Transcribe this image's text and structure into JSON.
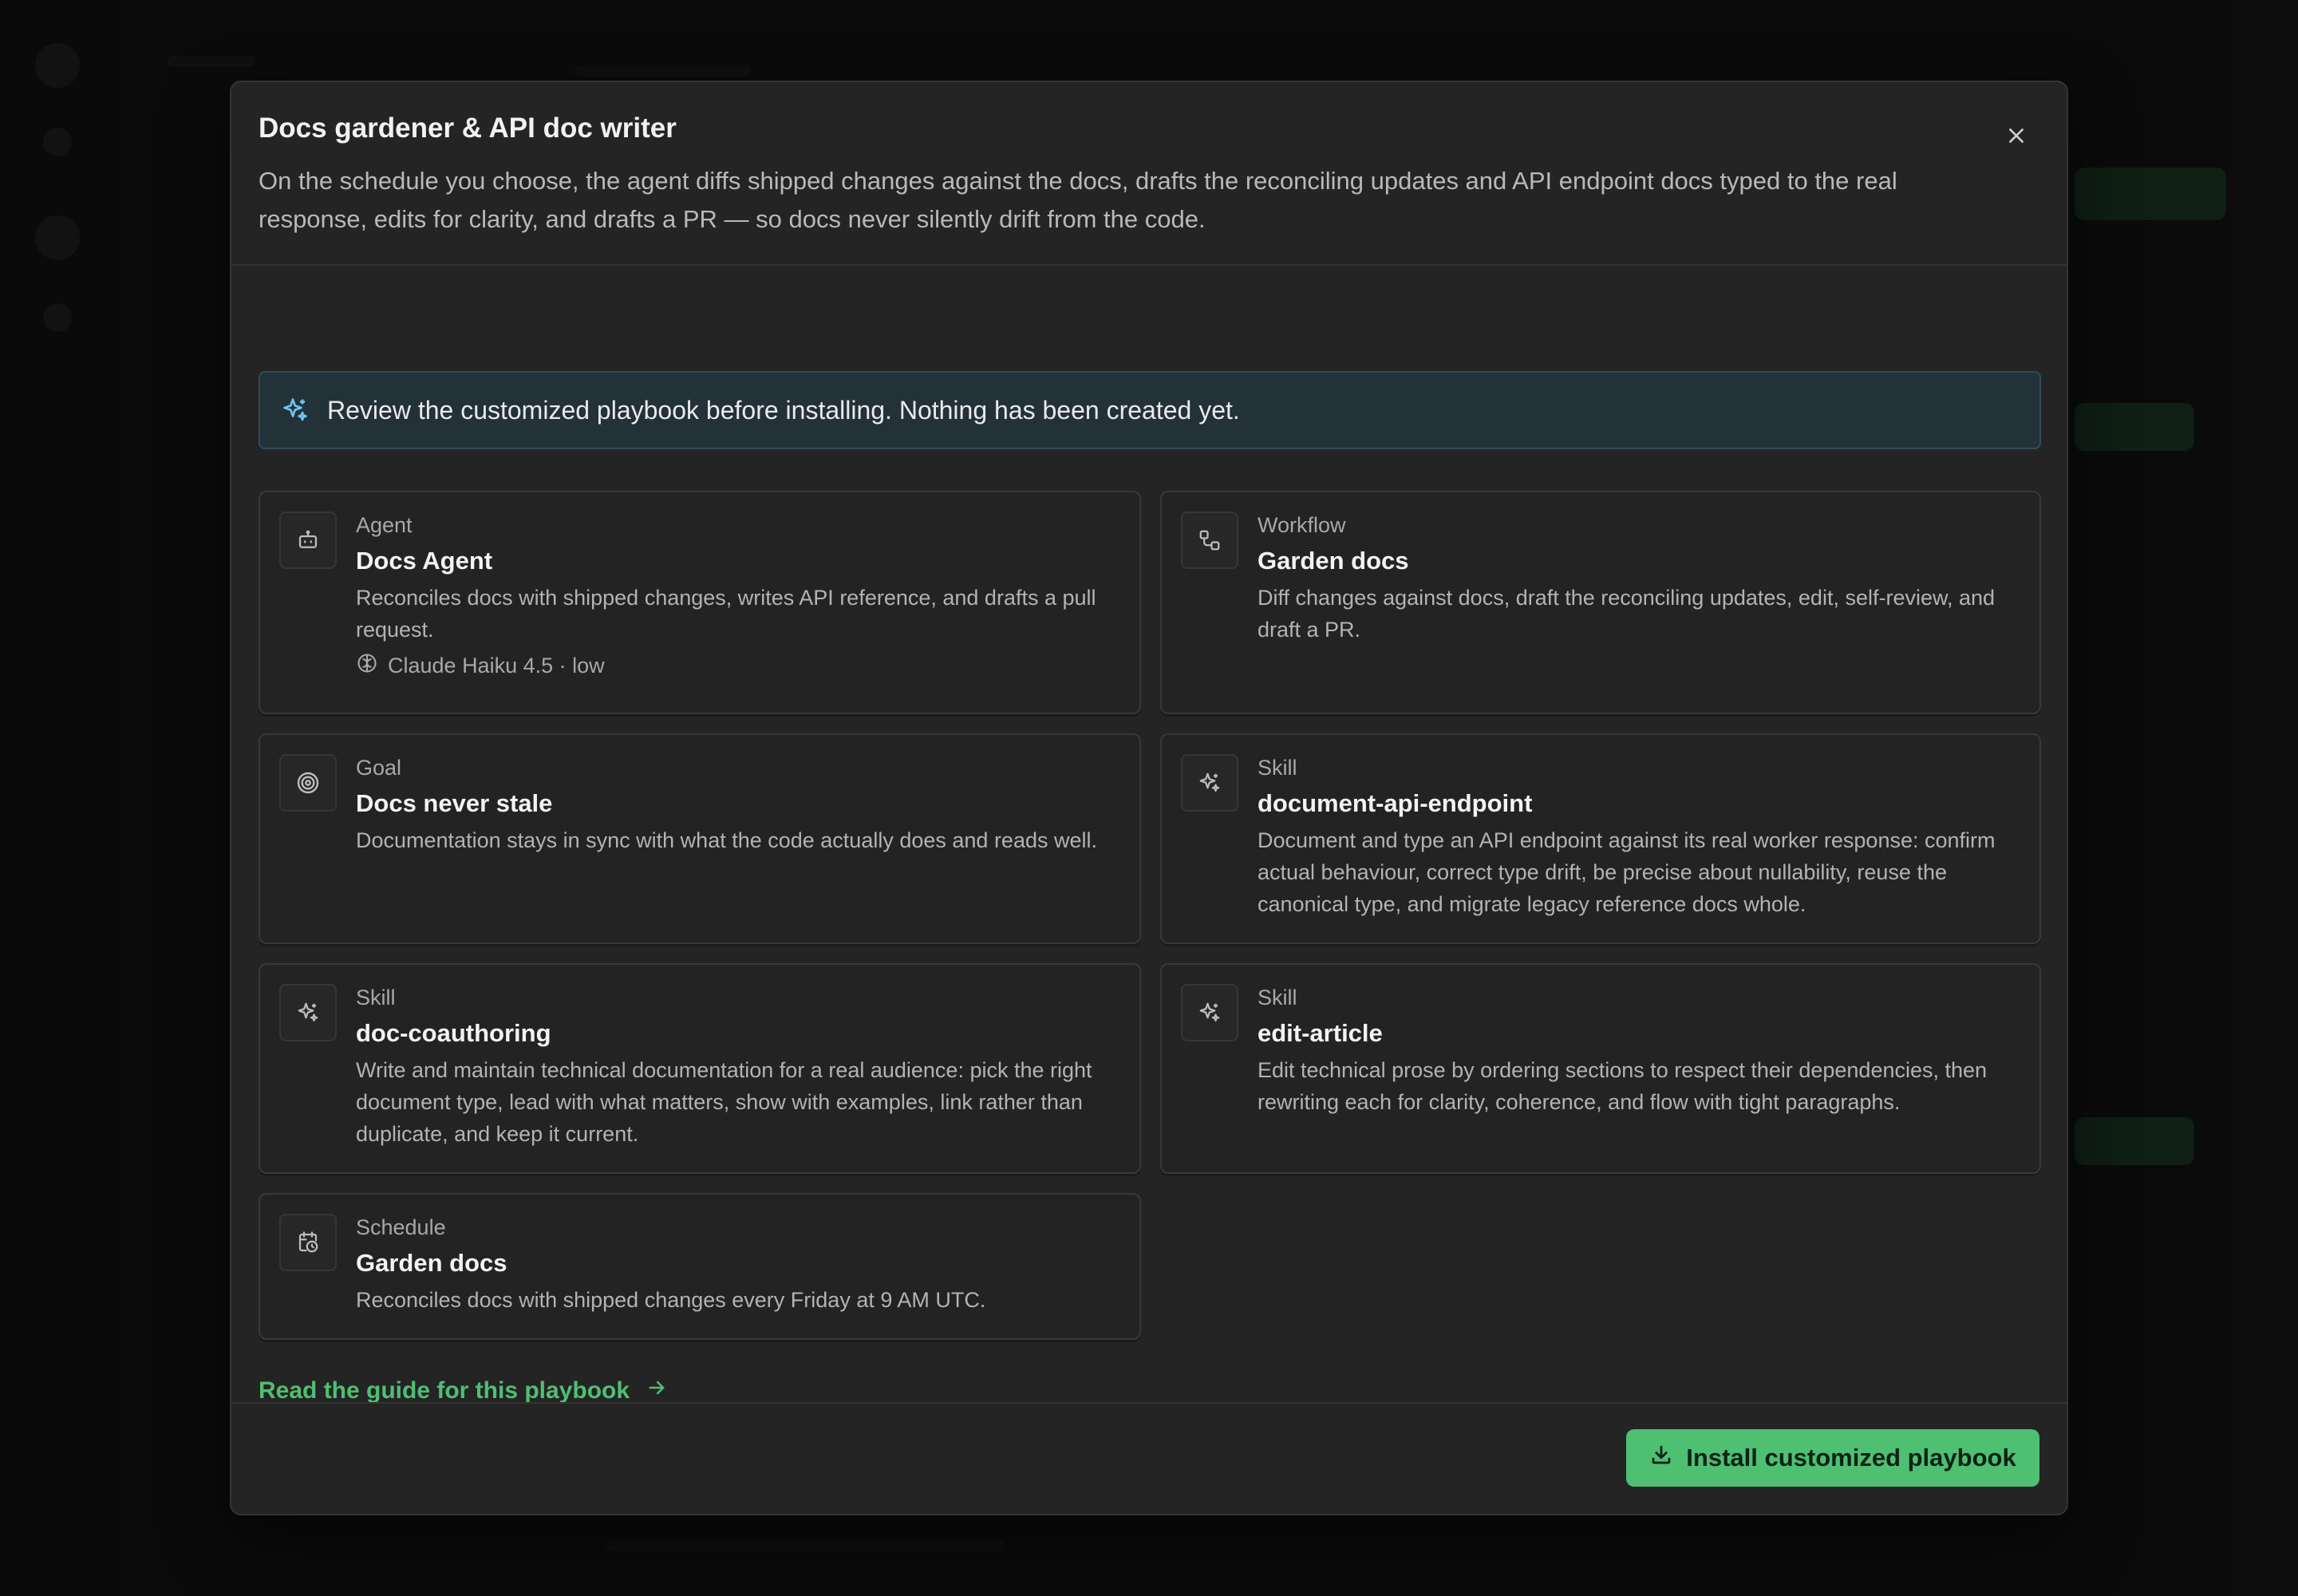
{
  "modal": {
    "title": "Docs gardener & API doc writer",
    "description": "On the schedule you choose, the agent diffs shipped changes against the docs, drafts the reconciling updates and API endpoint docs typed to the real response, edits for clarity, and drafts a PR — so docs never silently drift from the code.",
    "close_icon": "close-icon"
  },
  "banner": {
    "icon": "sparkles-icon",
    "text": "Review the customized playbook before installing. Nothing has been created yet."
  },
  "cards": [
    {
      "type": "Agent",
      "title": "Docs Agent",
      "description": "Reconciles docs with shipped changes, writes API reference, and drafts a pull request.",
      "meta": "Claude Haiku 4.5 · low",
      "icon": "robot-icon"
    },
    {
      "type": "Workflow",
      "title": "Garden docs",
      "description": "Diff changes against docs, draft the reconciling updates, edit, self-review, and draft a PR.",
      "icon": "workflow-icon"
    },
    {
      "type": "Goal",
      "title": "Docs never stale",
      "description": "Documentation stays in sync with what the code actually does and reads well.",
      "icon": "target-icon"
    },
    {
      "type": "Skill",
      "title": "document-api-endpoint",
      "description": "Document and type an API endpoint against its real worker response: confirm actual behaviour, correct type drift, be precise about nullability, reuse the canonical type, and migrate legacy reference docs whole.",
      "icon": "sparkles-icon"
    },
    {
      "type": "Skill",
      "title": "doc-coauthoring",
      "description": "Write and maintain technical documentation for a real audience: pick the right document type, lead with what matters, show with examples, link rather than duplicate, and keep it current.",
      "icon": "sparkles-icon"
    },
    {
      "type": "Skill",
      "title": "edit-article",
      "description": "Edit technical prose by ordering sections to respect their dependencies, then rewriting each for clarity, coherence, and flow with tight paragraphs.",
      "icon": "sparkles-icon"
    },
    {
      "type": "Schedule",
      "title": "Garden docs",
      "description": "Reconciles docs with shipped changes every Friday at 9 AM UTC.",
      "icon": "calendar-clock-icon"
    }
  ],
  "guide_link": {
    "label": "Read the guide for this playbook",
    "icon": "arrow-right-icon"
  },
  "footer": {
    "install_label": "Install customized playbook",
    "install_icon": "download-icon"
  },
  "colors": {
    "accent_green": "#4fbf72",
    "banner_bg": "#233139",
    "modal_bg": "#242424"
  }
}
